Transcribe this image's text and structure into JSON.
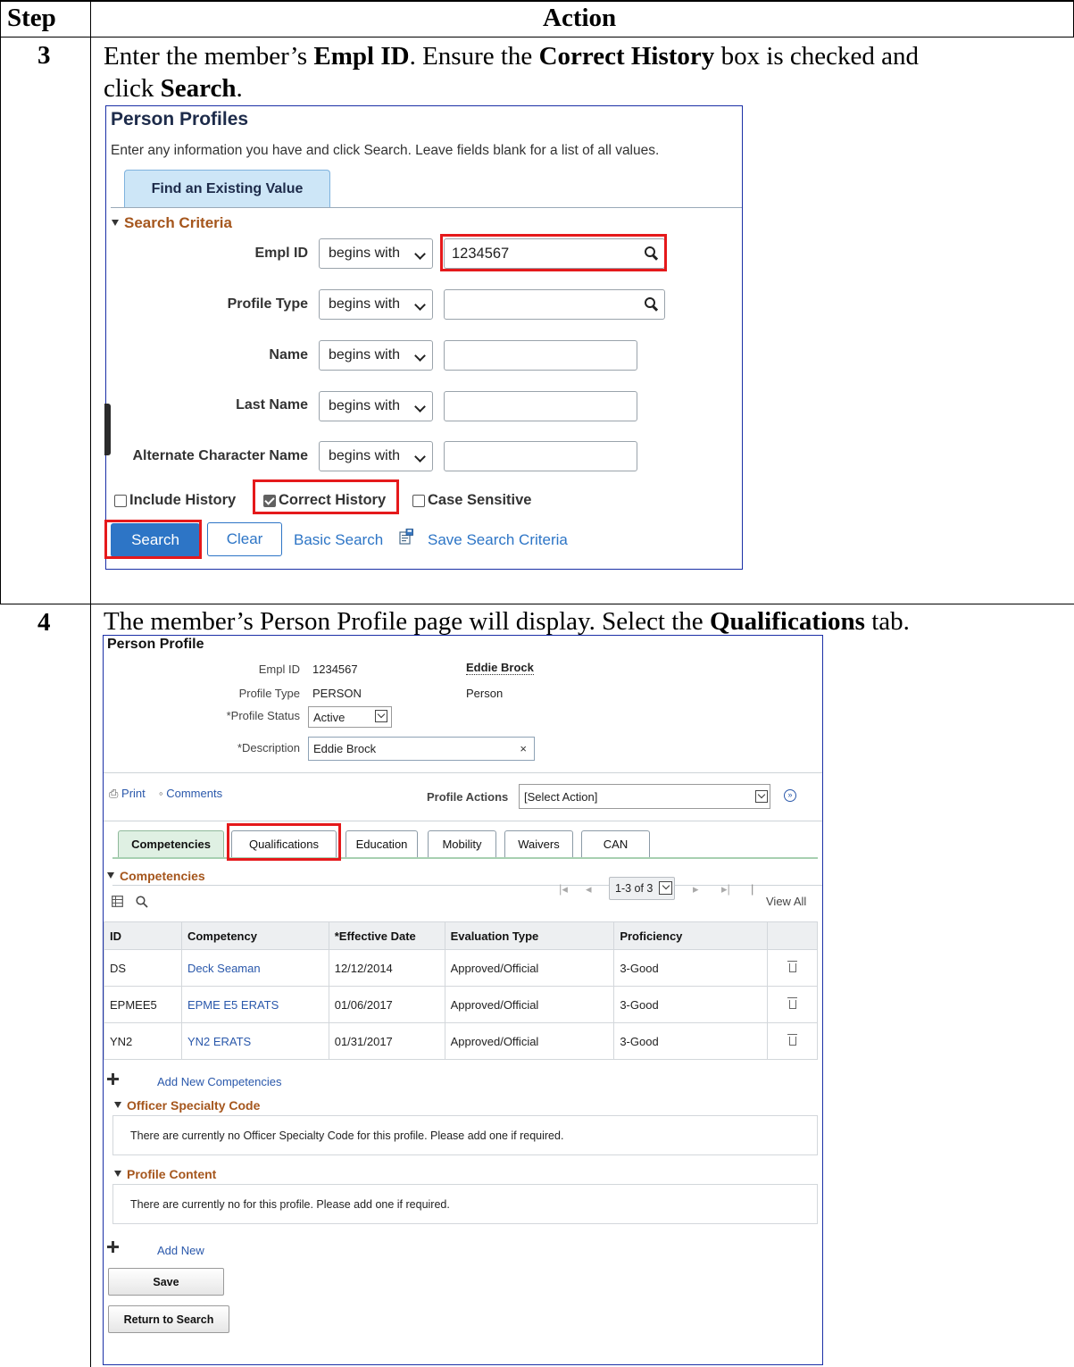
{
  "table_headers": {
    "step": "Step",
    "action": "Action"
  },
  "step3": {
    "number": "3",
    "instruction": {
      "pre": "Enter the member’s ",
      "b1": "Empl ID",
      "mid": ".  Ensure the ",
      "b2": "Correct History",
      "post": " box is checked and",
      "line2_pre": "click ",
      "b3": "Search",
      "line2_post": "."
    }
  },
  "search_page": {
    "title": "Person Profiles",
    "subtitle": "Enter any information you have and click Search. Leave fields blank for a list of all values.",
    "tab": "Find an Existing Value",
    "section": "Search Criteria",
    "fields": [
      {
        "label": "Empl ID",
        "operator": "begins with",
        "value": "1234567",
        "lookup": true
      },
      {
        "label": "Profile Type",
        "operator": "begins with",
        "value": "",
        "lookup": true
      },
      {
        "label": "Name",
        "operator": "begins with",
        "value": ""
      },
      {
        "label": "Last Name",
        "operator": "begins with",
        "value": ""
      },
      {
        "label": "Alternate Character Name",
        "operator": "begins with",
        "value": ""
      }
    ],
    "checkboxes": [
      {
        "label": "Include History",
        "checked": false
      },
      {
        "label": "Correct History",
        "checked": true
      },
      {
        "label": "Case Sensitive",
        "checked": false
      }
    ],
    "buttons": {
      "search": "Search",
      "clear": "Clear"
    },
    "links": {
      "basic_search": "Basic Search",
      "save_criteria": "Save Search Criteria"
    }
  },
  "step4": {
    "number": "4",
    "instruction": {
      "pre": "The member’s Person Profile page will display.  Select the ",
      "b1": "Qualifications",
      "post": " tab."
    }
  },
  "profile_page": {
    "title": "Person Profile",
    "empl_id_label": "Empl ID",
    "empl_id": "1234567",
    "person_name": "Eddie Brock",
    "profile_type_label": "Profile Type",
    "profile_type": "PERSON",
    "profile_type_desc": "Person",
    "status_label": "*Profile Status",
    "status": "Active",
    "description_label": "*Description",
    "description": "Eddie Brock",
    "clear_x": "×",
    "print": "Print",
    "comments": "Comments",
    "profile_actions_label": "Profile Actions",
    "profile_actions_value": "[Select Action]",
    "tabs": [
      "Competencies",
      "Qualifications",
      "Education",
      "Mobility",
      "Waivers",
      "CAN"
    ],
    "competencies_section": "Competencies",
    "pager_text": "1-3 of 3",
    "view_all": "View All",
    "columns": [
      "ID",
      "Competency",
      "*Effective Date",
      "Evaluation Type",
      "Proficiency"
    ],
    "rows": [
      {
        "id": "DS",
        "competency": "Deck Seaman",
        "date": "12/12/2014",
        "eval": "Approved/Official",
        "prof": "3-Good"
      },
      {
        "id": "EPMEE5",
        "competency": "EPME E5 ERATS",
        "date": "01/06/2017",
        "eval": "Approved/Official",
        "prof": "3-Good"
      },
      {
        "id": "YN2",
        "competency": "YN2 ERATS",
        "date": "01/31/2017",
        "eval": "Approved/Official",
        "prof": "3-Good"
      }
    ],
    "add_competencies": "Add New Competencies",
    "osc_section": "Officer Specialty Code",
    "osc_msg": "There are currently no Officer Specialty Code for this profile.  Please add one if required.",
    "content_section": "Profile Content",
    "content_msg": "There are currently no  for this profile.  Please add one if required.",
    "add_new": "Add New",
    "save": "Save",
    "return": "Return to Search"
  }
}
